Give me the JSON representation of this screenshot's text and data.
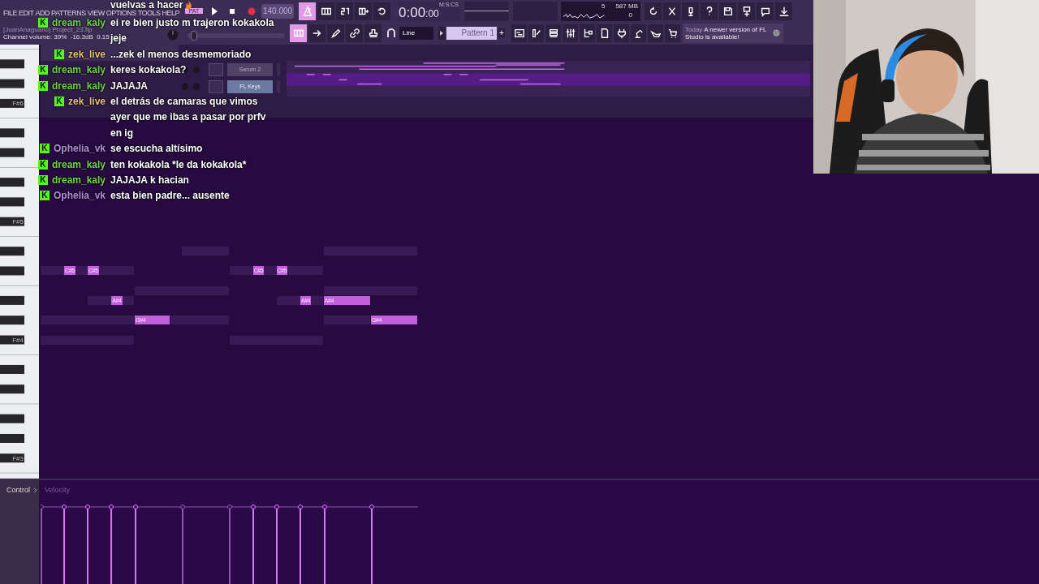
{
  "menu": [
    "FILE",
    "EDIT",
    "ADD",
    "PATTERNS",
    "VIEW",
    "OPTIONS",
    "TOOLS",
    "HELP"
  ],
  "pat_label": "PAT",
  "tempo": "140.000",
  "record_modes": [
    {
      "selected": true
    },
    {
      "selected": false
    },
    {
      "selected": false
    },
    {
      "selected": false
    },
    {
      "selected": false
    }
  ],
  "time": "0:00",
  "time_small": ":00",
  "time_format": "M:S:CS",
  "cpu": "5",
  "memory": "587 MB",
  "polyphony": "0",
  "project": "[JuanAnaguano] Project_23.flp",
  "hint": "Channel volume: 39%  -16.3dB  0.15",
  "master_pitch": {
    "level": 0.03
  },
  "tools": [
    {
      "selected": true
    },
    {
      "selected": false
    },
    {
      "selected": false
    },
    {
      "selected": false
    },
    {
      "selected": false
    }
  ],
  "snap": "Line",
  "pattern": "Pattern 1",
  "pattern_add": "+",
  "news": {
    "day": "Today",
    "text": "A newer version of FL Studio is available!"
  },
  "channels": [
    {
      "name": "Serum 2",
      "selected": false
    },
    {
      "name": "FL Keys",
      "selected": true
    }
  ],
  "key_labels": [
    "F#6",
    "F#5",
    "F#4",
    "F#3"
  ],
  "notes": [
    {
      "label": "C#5"
    },
    {
      "label": "C#5"
    },
    {
      "label": "C#5"
    },
    {
      "label": "C#5"
    },
    {
      "label": "A#4"
    },
    {
      "label": "A#4"
    },
    {
      "label": "A#4"
    },
    {
      "label": "G#4"
    },
    {
      "label": "G#4"
    }
  ],
  "control": {
    "label": "Control",
    "target": "Velocity"
  },
  "chat": [
    {
      "text": "vuelvas a hacer",
      "fire": true
    },
    {
      "badge": "K",
      "user": "dream_kaly",
      "color": "#6fd34a",
      "text": "ei re bien justo m trajeron kokakola"
    },
    {
      "text": "jeje"
    },
    {
      "badge": "K",
      "user": "zek_live",
      "color": "#e9c27a",
      "text": "...zek el menos desmemoriado"
    },
    {
      "badge": "K",
      "user": "dream_kaly",
      "color": "#6fd34a",
      "text": "keres kokakola?"
    },
    {
      "badge": "K",
      "user": "dream_kaly",
      "color": "#6fd34a",
      "text": "JAJAJA"
    },
    {
      "badge": "K",
      "user": "zek_live",
      "color": "#e9c27a",
      "text": "el detrás de camaras que vimos"
    },
    {
      "text": "ayer que me ibas a pasar por prfv"
    },
    {
      "text": "en ig"
    },
    {
      "badge": "K",
      "user": "Ophelia_vk",
      "color": "#b48de0",
      "text": "se escucha altísimo"
    },
    {
      "badge": "K",
      "user": "dream_kaly",
      "color": "#6fd34a",
      "text": "ten kokakola *le da kokakola*"
    },
    {
      "badge": "K",
      "user": "dream_kaly",
      "color": "#6fd34a",
      "text": "JAJAJA k hacian"
    },
    {
      "badge": "K",
      "user": "Ophelia_vk",
      "color": "#b48de0",
      "text": "esta bien padre... ausente"
    }
  ],
  "webcam": {
    "kind": "picture"
  }
}
